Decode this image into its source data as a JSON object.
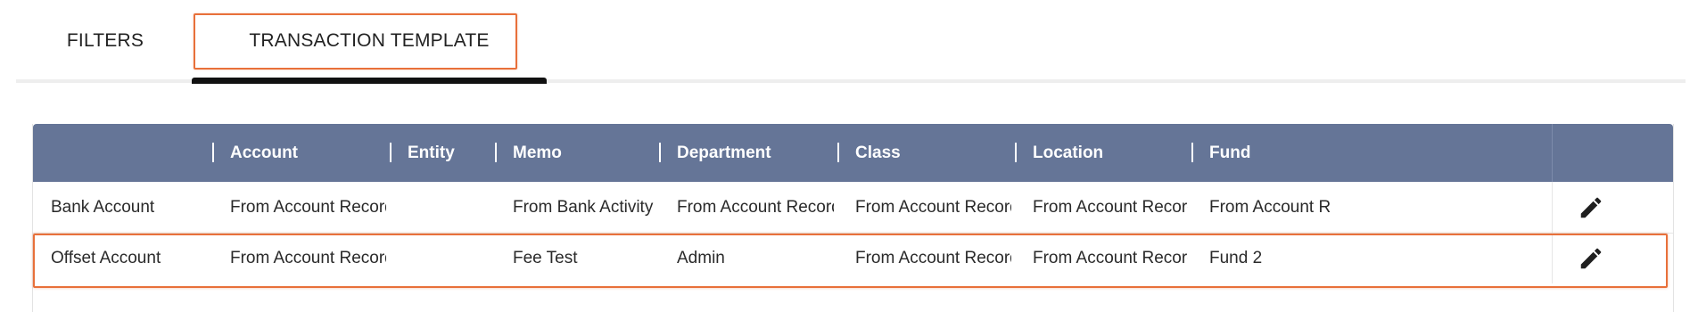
{
  "tabs": [
    {
      "label": "FILTERS",
      "active": false
    },
    {
      "label": "TRANSACTION TEMPLATE",
      "active": true
    }
  ],
  "table": {
    "columns": [
      "",
      "Account",
      "Entity",
      "Memo",
      "Department",
      "Class",
      "Location",
      "Fund"
    ],
    "rows": [
      [
        "Bank Account",
        "From Account Record",
        "",
        "From Bank Activity",
        "From Account Record",
        "From Account Record",
        "From Account Record",
        "From Account Record"
      ],
      [
        "Offset Account",
        "From Account Record",
        "",
        "Fee Test",
        "Admin",
        "From Account Record",
        "From Account Record",
        "Fund 2"
      ]
    ],
    "row_action_icon": "pencil-edit-icon"
  },
  "colors": {
    "header_bg": "#657597",
    "highlight": "#e8703a",
    "active_tab_bar": "#111111"
  }
}
